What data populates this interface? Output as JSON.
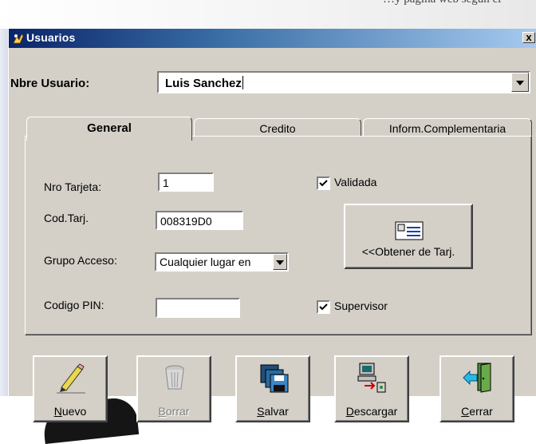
{
  "page": {
    "header_text": "…y página web según el"
  },
  "window": {
    "title": "Usuarios",
    "close_label": "x"
  },
  "user": {
    "label": "Nbre Usuario:",
    "value": "Luis Sanchez"
  },
  "tabs": [
    {
      "label": "General",
      "active": true
    },
    {
      "label": "Credito",
      "active": false
    },
    {
      "label": "Inform.Complementaria",
      "active": false
    }
  ],
  "general": {
    "nro_tarjeta": {
      "label": "Nro Tarjeta:",
      "value": "1"
    },
    "cod_tarj": {
      "label": "Cod.Tarj.",
      "value": "008319D0"
    },
    "grupo_acceso": {
      "label": "Grupo Acceso:",
      "value": "Cualquier lugar en"
    },
    "codigo_pin": {
      "label": "Codigo PIN:",
      "value": ""
    },
    "validada": {
      "label": "Validada",
      "checked": true
    },
    "supervisor": {
      "label": "Supervisor",
      "checked": true
    },
    "obtener_label": "<<Obtener de Tarj."
  },
  "buttons": [
    {
      "key": "nuevo",
      "label": "Nuevo",
      "underline": "N",
      "rest": "uevo",
      "enabled": true,
      "icon": "pencil-icon"
    },
    {
      "key": "borrar",
      "label": "Borrar",
      "underline": "B",
      "rest": "orrar",
      "enabled": false,
      "icon": "trash-icon"
    },
    {
      "key": "salvar",
      "label": "Salvar",
      "underline": "S",
      "rest": "alvar",
      "enabled": true,
      "icon": "floppy-disks-icon"
    },
    {
      "key": "descargar",
      "label": "Descargar",
      "underline": "D",
      "rest": "escargar",
      "enabled": true,
      "icon": "computer-download-icon"
    },
    {
      "key": "cerrar",
      "label": "Cerrar",
      "underline": "C",
      "rest": "errar",
      "enabled": true,
      "icon": "exit-door-icon"
    }
  ],
  "colors": {
    "face": "#d4d0c8",
    "title_start": "#0a246a",
    "title_end": "#a6caf0"
  }
}
